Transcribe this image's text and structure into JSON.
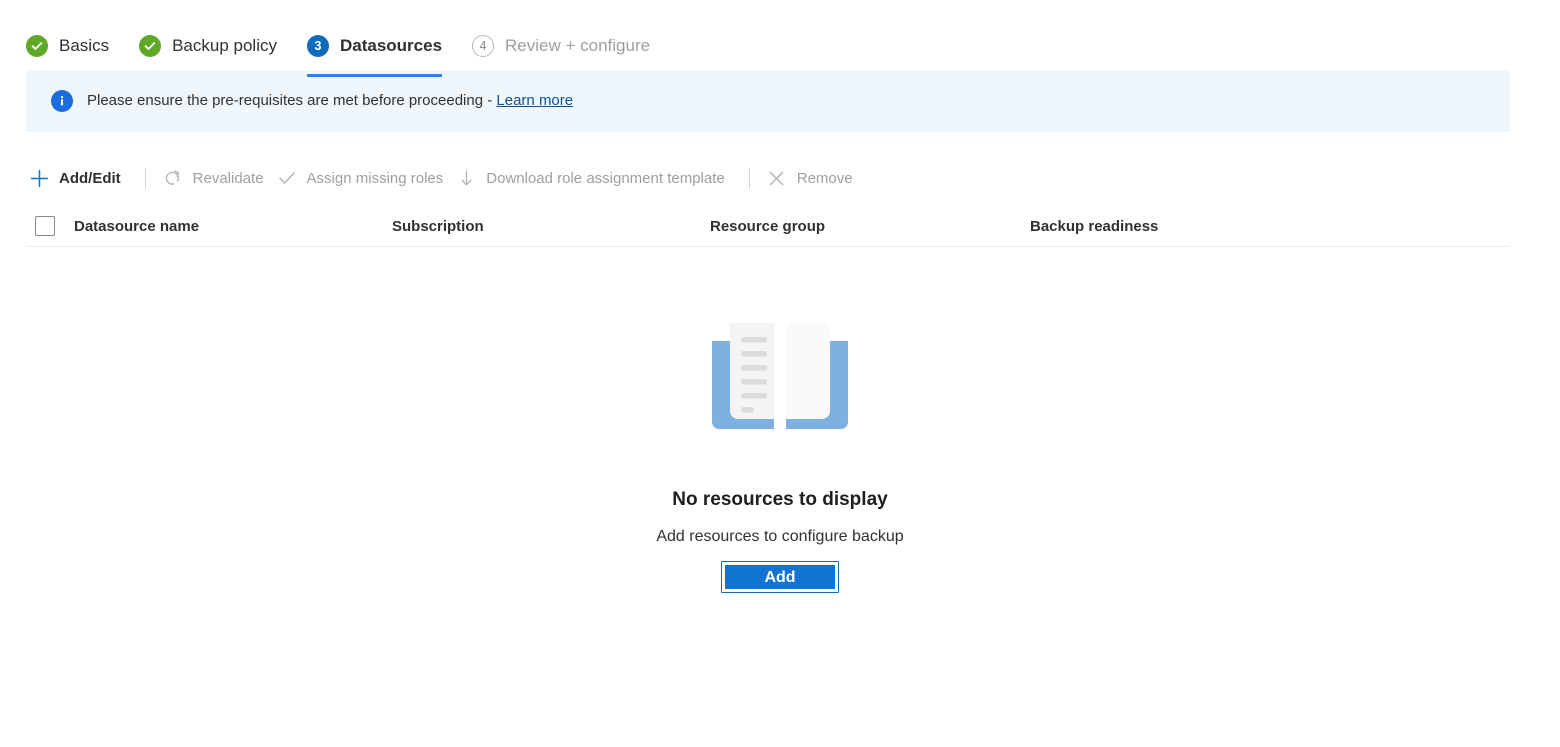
{
  "wizard": {
    "steps": [
      {
        "label": "Basics",
        "state": "done",
        "badge": "check-icon"
      },
      {
        "label": "Backup policy",
        "state": "done",
        "badge": "check-icon"
      },
      {
        "label": "Datasources",
        "state": "current",
        "badge": "3"
      },
      {
        "label": "Review + configure",
        "state": "pending",
        "badge": "4"
      }
    ]
  },
  "banner": {
    "icon": "info-icon",
    "message": "Please ensure the pre-requisites are met before proceeding - ",
    "link_label": "Learn more"
  },
  "toolbar": {
    "commands": [
      {
        "label": "Add/Edit",
        "icon": "plus-icon",
        "enabled": true
      },
      {
        "label": "Revalidate",
        "icon": "refresh-icon",
        "enabled": false
      },
      {
        "label": "Assign missing roles",
        "icon": "checkmark-icon",
        "enabled": false
      },
      {
        "label": "Download role assignment template",
        "icon": "download-icon",
        "enabled": false
      },
      {
        "label": "Remove",
        "icon": "close-x-icon",
        "enabled": false
      }
    ]
  },
  "grid": {
    "select_all_checked": false,
    "columns": [
      "Datasource name",
      "Subscription",
      "Resource group",
      "Backup readiness"
    ],
    "rows": []
  },
  "empty_state": {
    "illustration": "open-book-icon",
    "title": "No resources to display",
    "subtitle": "Add resources to configure backup",
    "button_label": "Add"
  },
  "colors": {
    "accent_blue": "#0078d4",
    "step_current_blue": "#0f6cbd",
    "underline_blue": "#2b88d8",
    "success_green": "#5fa828",
    "banner_bg": "#eff6fc",
    "info_blue": "#1a6ddc",
    "button_blue": "#1274d1",
    "link_blue": "#0f548c",
    "disabled_gray": "#a19f9d",
    "book_cover_blue": "#7cb1e0"
  }
}
